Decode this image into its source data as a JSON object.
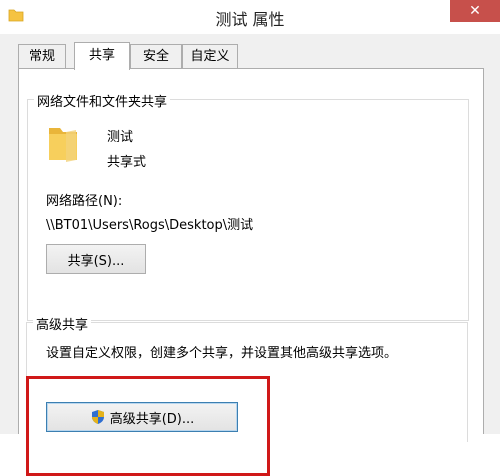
{
  "window": {
    "title": "测试 属性",
    "close_label": "✕"
  },
  "tabs": [
    {
      "label": "常规",
      "active": false
    },
    {
      "label": "共享",
      "active": true
    },
    {
      "label": "安全",
      "active": false
    },
    {
      "label": "自定义",
      "active": false
    }
  ],
  "network_share": {
    "group_label": "网络文件和文件夹共享",
    "folder_name": "测试",
    "share_status": "共享式",
    "path_label": "网络路径(N):",
    "path_value": "\\\\BT01\\Users\\Rogs\\Desktop\\测试",
    "share_button": "共享(S)..."
  },
  "advanced_share": {
    "group_label": "高级共享",
    "description": "设置自定义权限，创建多个共享，并设置其他高级共享选项。",
    "button_label": "高级共享(D)..."
  },
  "colors": {
    "close": "#c7504b",
    "highlight": "#d01818",
    "folder": "#f5c342"
  }
}
